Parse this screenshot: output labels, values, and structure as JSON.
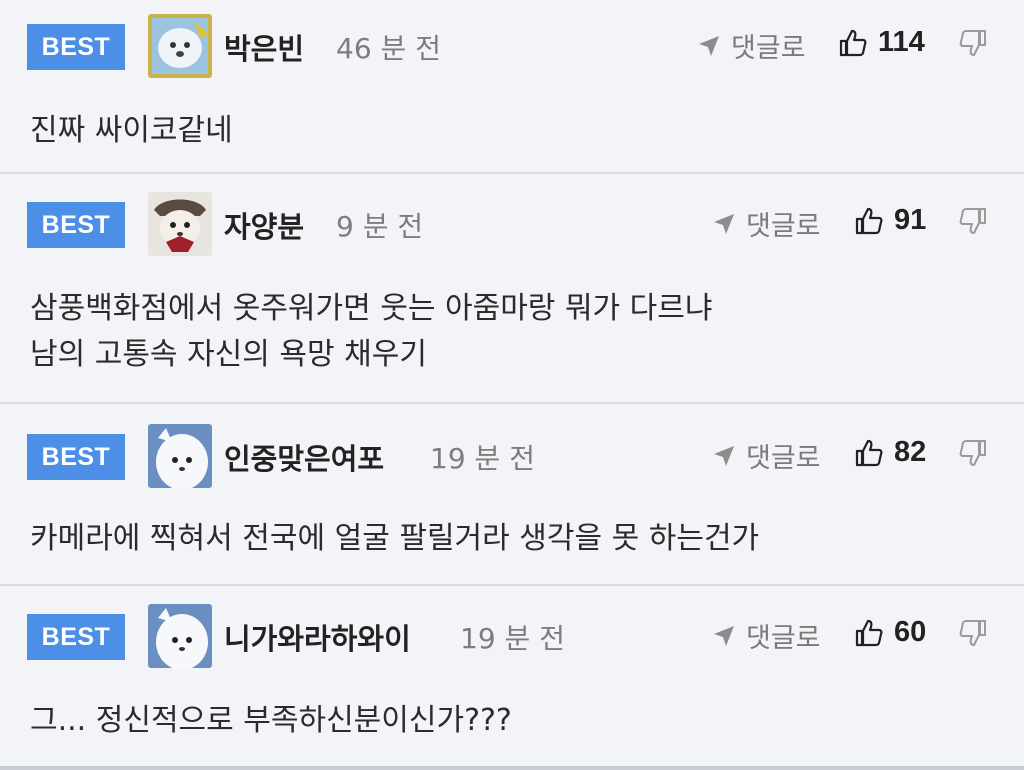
{
  "comments": [
    {
      "badge": "BEST",
      "nickname": "박은빈",
      "time": "46 분 전",
      "reply_label": "댓글로",
      "likes": "114",
      "lines": [
        "진짜 싸이코같네"
      ]
    },
    {
      "badge": "BEST",
      "nickname": "자양분",
      "time": "9 분 전",
      "reply_label": "댓글로",
      "likes": "91",
      "lines": [
        "삼풍백화점에서 옷주워가면 웃는 아줌마랑 뭐가 다르냐",
        "남의 고통속 자신의 욕망 채우기"
      ]
    },
    {
      "badge": "BEST",
      "nickname": "인중맞은여포",
      "time": "19 분 전",
      "reply_label": "댓글로",
      "likes": "82",
      "lines": [
        "카메라에 찍혀서 전국에 얼굴 팔릴거라 생각을 못 하는건가"
      ]
    },
    {
      "badge": "BEST",
      "nickname": "니가와라하와이",
      "time": "19 분 전",
      "reply_label": "댓글로",
      "likes": "60",
      "lines": [
        "그... 정신적으로 부족하신분이신가???"
      ]
    }
  ],
  "icons": {
    "reply": "reply-arrow-icon",
    "like": "thumbs-up-icon",
    "dislike": "thumbs-down-icon"
  },
  "colors": {
    "best_badge": "#4d8fe6",
    "background": "#f2f4f8",
    "divider": "#d9dde3"
  }
}
